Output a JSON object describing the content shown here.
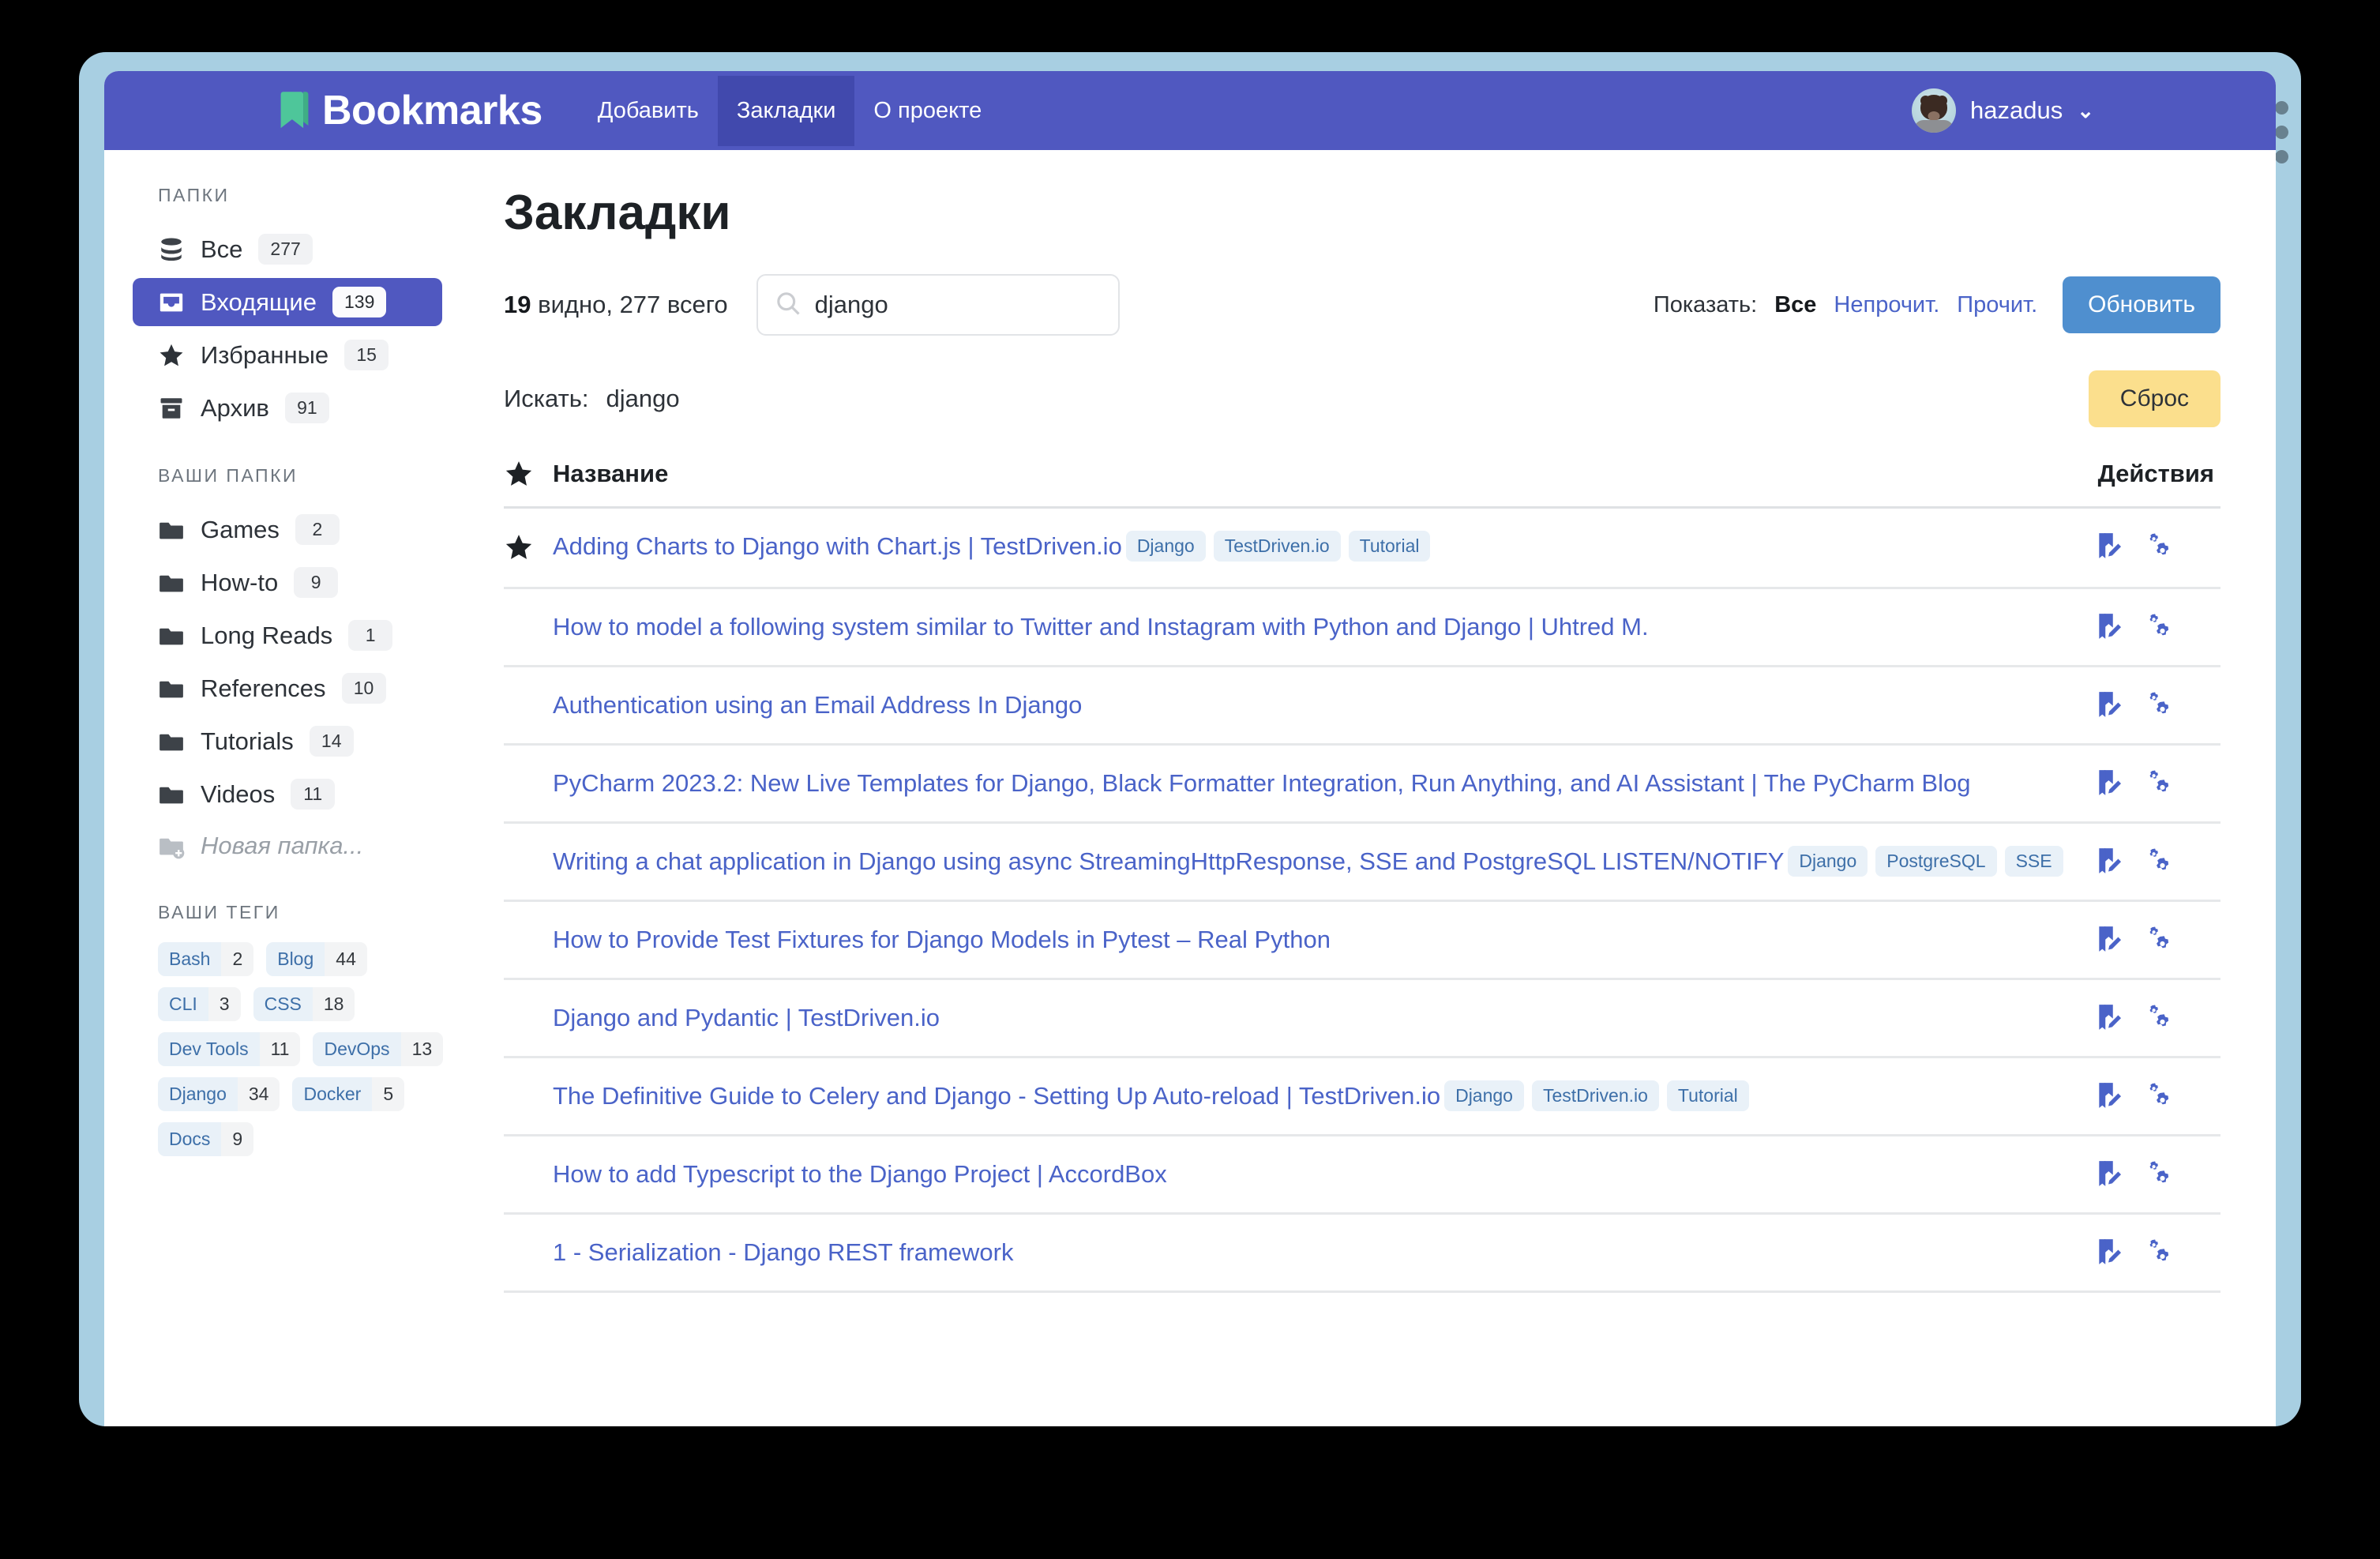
{
  "navbar": {
    "brand": "Bookmarks",
    "brand_icon": "bookmark-icon",
    "links": [
      {
        "label": "Добавить",
        "active": false
      },
      {
        "label": "Закладки",
        "active": true
      },
      {
        "label": "О проекте",
        "active": false
      }
    ],
    "username": "hazadus",
    "chevron": "⌄"
  },
  "sidebar": {
    "folders_heading": "ПАПКИ",
    "folders": [
      {
        "label": "Все",
        "count": "277",
        "icon": "database-icon",
        "active": false
      },
      {
        "label": "Входящие",
        "count": "139",
        "icon": "inbox-icon",
        "active": true
      },
      {
        "label": "Избранные",
        "count": "15",
        "icon": "star-icon",
        "active": false
      },
      {
        "label": "Архив",
        "count": "91",
        "icon": "archive-icon",
        "active": false
      }
    ],
    "user_folders_heading": "ВАШИ ПАПКИ",
    "user_folders": [
      {
        "label": "Games",
        "count": "2",
        "icon": "folder-icon"
      },
      {
        "label": "How-to",
        "count": "9",
        "icon": "folder-icon"
      },
      {
        "label": "Long Reads",
        "count": "1",
        "icon": "folder-icon"
      },
      {
        "label": "References",
        "count": "10",
        "icon": "folder-icon"
      },
      {
        "label": "Tutorials",
        "count": "14",
        "icon": "folder-icon"
      },
      {
        "label": "Videos",
        "count": "11",
        "icon": "folder-icon"
      }
    ],
    "new_folder_label": "Новая папка...",
    "new_folder_icon": "folder-plus-icon",
    "tags_heading": "ВАШИ ТЕГИ",
    "tags": [
      {
        "name": "Bash",
        "count": "2"
      },
      {
        "name": "Blog",
        "count": "44"
      },
      {
        "name": "CLI",
        "count": "3"
      },
      {
        "name": "CSS",
        "count": "18"
      },
      {
        "name": "Dev Tools",
        "count": "11"
      },
      {
        "name": "DevOps",
        "count": "13"
      },
      {
        "name": "Django",
        "count": "34"
      },
      {
        "name": "Docker",
        "count": "5"
      },
      {
        "name": "Docs",
        "count": "9"
      }
    ]
  },
  "main": {
    "title": "Закладки",
    "visible_count": "19",
    "visible_suffix": " видно, ",
    "total_count": "277",
    "total_suffix": " всего",
    "search_value": "django",
    "search_placeholder": "",
    "search_icon": "search-icon",
    "show_label": "Показать:",
    "filters": [
      {
        "label": "Все",
        "active": true
      },
      {
        "label": "Непрочит.",
        "active": false
      },
      {
        "label": "Прочит.",
        "active": false
      }
    ],
    "refresh_label": "Обновить",
    "search_row_label": "Искать:",
    "search_row_term": "django",
    "reset_label": "Сброс",
    "col_star_icon": "star-icon",
    "col_name": "Название",
    "col_actions": "Действия",
    "edit_icon": "bookmark-edit-icon",
    "settings_icon": "gears-icon"
  },
  "bookmarks": [
    {
      "title": "Adding Charts to Django with Chart.js | TestDriven.io",
      "tags": [
        "Django",
        "TestDriven.io",
        "Tutorial"
      ],
      "starred": true
    },
    {
      "title": "How to model a following system similar to Twitter and Instagram with Python and Django | Uhtred M.",
      "tags": [],
      "starred": false
    },
    {
      "title": "Authentication using an Email Address In Django",
      "tags": [],
      "starred": false
    },
    {
      "title": "PyCharm 2023.2: New Live Templates for Django, Black Formatter Integration, Run Anything, and AI Assistant | The PyCharm Blog",
      "tags": [],
      "starred": false
    },
    {
      "title": "Writing a chat application in Django using async StreamingHttpResponse, SSE and PostgreSQL LISTEN/NOTIFY",
      "tags": [
        "Django",
        "PostgreSQL",
        "SSE"
      ],
      "starred": false
    },
    {
      "title": "How to Provide Test Fixtures for Django Models in Pytest – Real Python",
      "tags": [],
      "starred": false
    },
    {
      "title": "Django and Pydantic | TestDriven.io",
      "tags": [],
      "starred": false
    },
    {
      "title": "The Definitive Guide to Celery and Django - Setting Up Auto-reload | TestDriven.io",
      "tags": [
        "Django",
        "TestDriven.io",
        "Tutorial"
      ],
      "starred": false
    },
    {
      "title": "How to add Typescript to the Django Project | AccordBox",
      "tags": [],
      "starred": false
    },
    {
      "title": "1 - Serialization - Django REST framework",
      "tags": [],
      "starred": false
    }
  ],
  "colors": {
    "navbar": "#5058c0",
    "nav_active": "#4149ad",
    "brand_icon": "#4ec69a",
    "window_frame": "#a8cfe2",
    "link": "#4a63c8",
    "tag_bg": "#e9f1f8",
    "tag_text": "#3d6fa8",
    "refresh_btn": "#4f8fcf",
    "reset_btn": "#fbdf8d"
  }
}
